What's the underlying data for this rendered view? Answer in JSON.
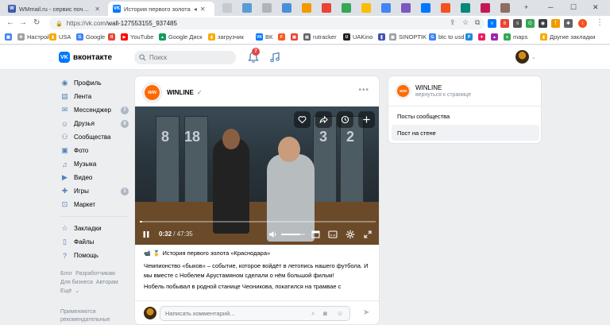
{
  "browser": {
    "tabs": [
      {
        "title": "WMmail.ru - сервис почтовых ре",
        "active": false
      },
      {
        "title": "История первого золота",
        "active": true
      }
    ],
    "url_host": "https://vk.com/",
    "url_path": "wall-127553155_937485",
    "bookmarks": [
      "Настройки",
      "USA",
      "Google",
      "YouTube",
      "Google Диск",
      "загрузчик",
      "ВК",
      "rutracker",
      "UAKino",
      "SINOPTIK",
      "btc to usd",
      "maps",
      "Другие закладки"
    ]
  },
  "vk": {
    "logo_text": "вконтакте",
    "search_placeholder": "Поиск",
    "notifications_count": "7"
  },
  "nav": {
    "items": [
      {
        "label": "Профиль",
        "count": ""
      },
      {
        "label": "Лента",
        "count": ""
      },
      {
        "label": "Мессенджер",
        "count": "7"
      },
      {
        "label": "Друзья",
        "count": "9"
      },
      {
        "label": "Сообщества",
        "count": ""
      },
      {
        "label": "Фото",
        "count": ""
      },
      {
        "label": "Музыка",
        "count": ""
      },
      {
        "label": "Видео",
        "count": ""
      },
      {
        "label": "Игры",
        "count": "1"
      },
      {
        "label": "Маркет",
        "count": ""
      }
    ],
    "items2": [
      {
        "label": "Закладки"
      },
      {
        "label": "Файлы"
      },
      {
        "label": "Помощь"
      }
    ],
    "footer": [
      "Блог",
      "Разработчикам",
      "Для бизнеса",
      "Авторам",
      "Ещё"
    ],
    "recommended": "Применяются рекомендательные"
  },
  "post": {
    "author": "WINLINE",
    "logo_text": "WIN",
    "video": {
      "time_current": "0:32",
      "time_total": "/ 47:35",
      "progress": 0.011,
      "volume": 0.8,
      "locker_numbers": [
        "8",
        "18",
        "3",
        "2"
      ]
    },
    "caption": "История первого золота «Краснодара»",
    "text": [
      "Чемпионство «быков» – событие, которое войдёт в летопись нашего футбола. И мы вместе с Нобелем Арустамяном сделали о нём большой фильм!",
      "Нобель побывал в родной станице Чеониковa, покатился на трамвае с"
    ],
    "comment_placeholder": "Написать комментарий..."
  },
  "right_panel": {
    "name": "WINLINE",
    "back_link": "вернуться к странице",
    "items": [
      {
        "label": "Посты сообщества",
        "selected": false
      },
      {
        "label": "Пост на стене",
        "selected": true
      }
    ]
  }
}
